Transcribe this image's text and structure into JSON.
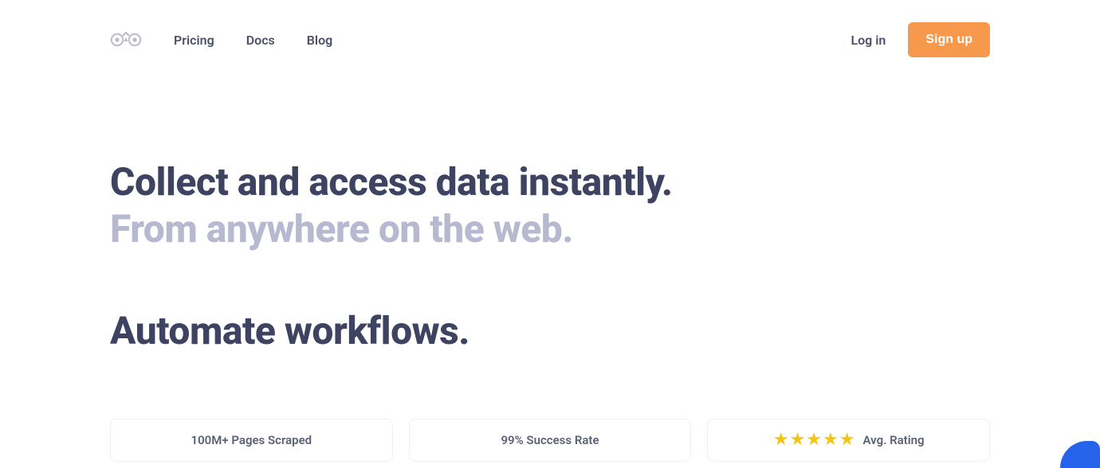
{
  "nav": {
    "pricing": "Pricing",
    "docs": "Docs",
    "blog": "Blog"
  },
  "auth": {
    "login": "Log in",
    "signup": "Sign up"
  },
  "hero": {
    "line1": "Collect and access data instantly.",
    "line2": "From anywhere on the web.",
    "line3": "Automate workflows."
  },
  "stats": {
    "card1": "100M+ Pages Scraped",
    "card2": "99% Success Rate",
    "card3_label": "Avg. Rating",
    "card3_stars": 5
  }
}
